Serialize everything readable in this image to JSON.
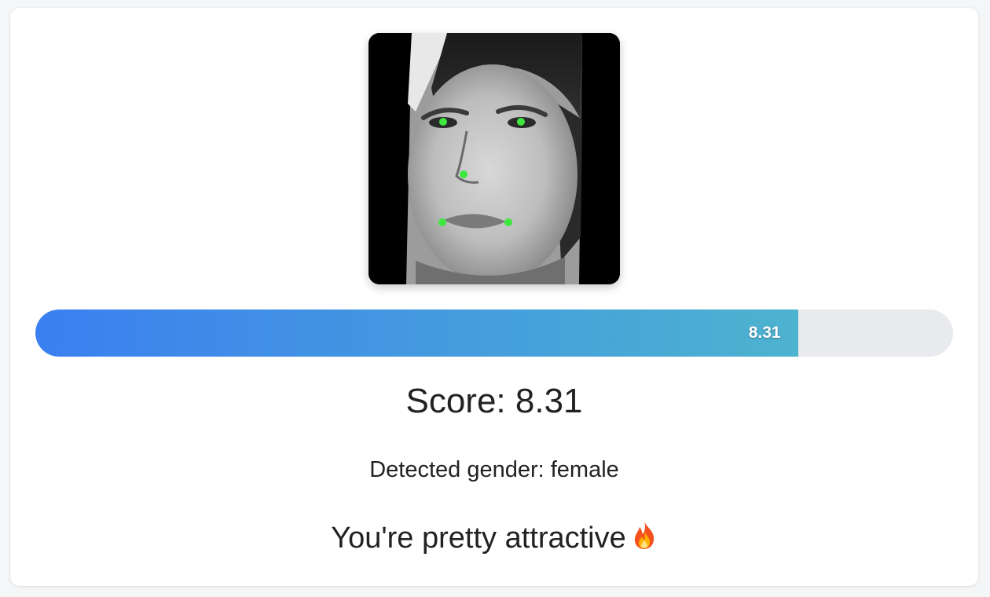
{
  "result": {
    "score_bar": {
      "value": 8.31,
      "max": 10,
      "label": "8.31",
      "gradient_start": "#3b7ff0",
      "gradient_end": "#4db3cf",
      "track_color": "#e9eaee"
    },
    "score_text": "Score: 8.31",
    "gender_text": "Detected gender: female",
    "verdict_text": "You're pretty attractive",
    "verdict_icon": "fire-icon"
  },
  "photo": {
    "icon": "face-photo",
    "landmark_color": "#3ee83e"
  }
}
